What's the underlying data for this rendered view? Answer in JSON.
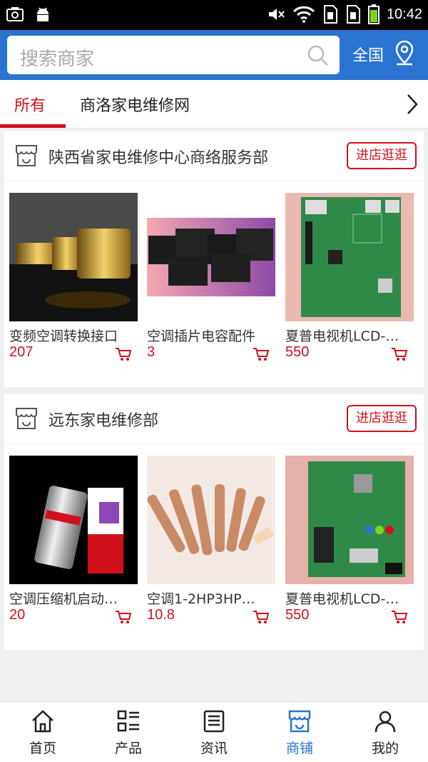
{
  "status_bar": {
    "time": "10:42"
  },
  "search": {
    "placeholder": "搜索商家",
    "region_label": "全国"
  },
  "tabs": [
    {
      "label": "所有",
      "active": true
    },
    {
      "label": "商洛家电维修网",
      "active": false
    }
  ],
  "stores": [
    {
      "name": "陕西省家电维修中心商络服务部",
      "visit_label": "进店逛逛",
      "products": [
        {
          "title": "变频空调转换接口",
          "price": "207"
        },
        {
          "title": "空调插片电容配件",
          "price": "3"
        },
        {
          "title": "夏普电视机LCD-…",
          "price": "550"
        }
      ]
    },
    {
      "name": "远东家电维修部",
      "visit_label": "进店逛逛",
      "products": [
        {
          "title": "空调压缩机启动…",
          "price": "20"
        },
        {
          "title": "空调1-2HP3HP…",
          "price": "10.8"
        },
        {
          "title": "夏普电视机LCD-…",
          "price": "550"
        }
      ]
    }
  ],
  "bottom_nav": [
    {
      "label": "首页",
      "icon": "home-icon"
    },
    {
      "label": "产品",
      "icon": "grid-list-icon"
    },
    {
      "label": "资讯",
      "icon": "news-icon"
    },
    {
      "label": "商铺",
      "icon": "store-icon",
      "active": true
    },
    {
      "label": "我的",
      "icon": "user-icon"
    }
  ],
  "colors": {
    "primary": "#2a73d0",
    "accent": "#d0111b",
    "background": "#f0f0f0"
  }
}
